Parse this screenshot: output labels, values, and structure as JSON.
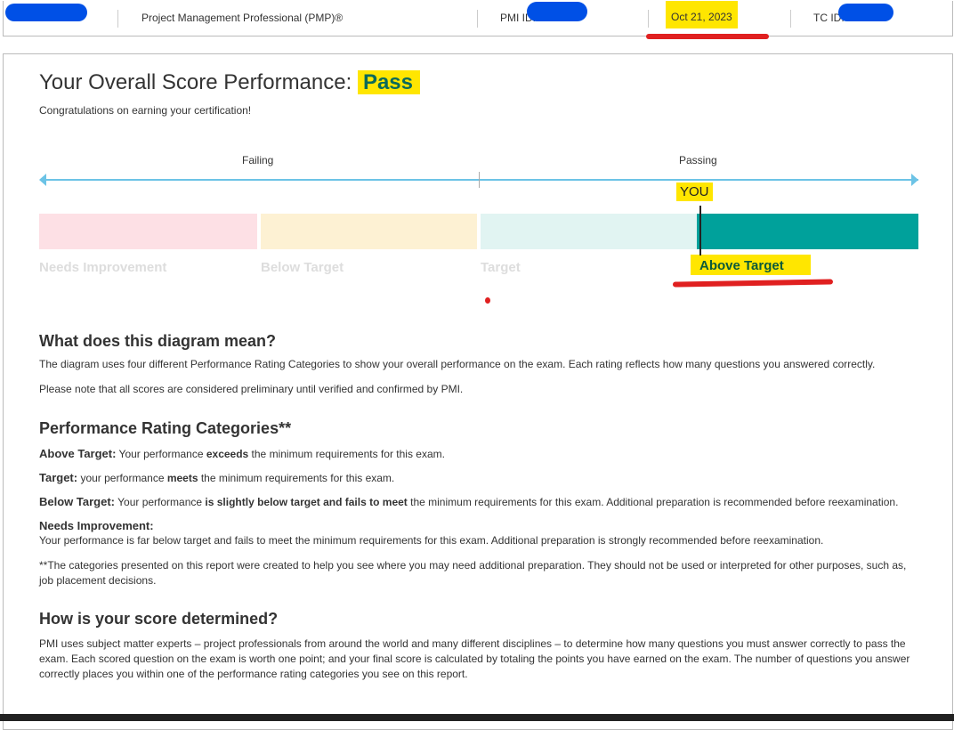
{
  "header": {
    "certification": "Project Management Professional (PMP)®",
    "pmi_id_label": "PMI ID:",
    "date": "Oct 21, 2023",
    "tc_id_label": "TC ID:"
  },
  "score": {
    "title": "Your Overall Score Performance:",
    "result": "Pass",
    "congrats": "Congratulations on earning your certification!"
  },
  "diagram": {
    "failing": "Failing",
    "passing": "Passing",
    "you": "YOU",
    "selected": "Above Target",
    "categories": [
      {
        "label": "Needs Improvement",
        "color": "#fde0e5"
      },
      {
        "label": "Below Target",
        "color": "#fdf1d3"
      },
      {
        "label": "Target",
        "color": "#e1f4f2"
      },
      {
        "label": "Above Target",
        "color": "#00a19b"
      }
    ]
  },
  "meaning": {
    "heading": "What does this diagram mean?",
    "p1": "The diagram uses four different Performance Rating Categories to show your overall performance on the exam. Each rating reflects how many questions you answered correctly.",
    "p2": "Please note that all scores are considered preliminary until verified and confirmed by PMI."
  },
  "ratings": {
    "heading": "Performance Rating Categories**",
    "above": {
      "term": "Above Target:",
      "a": " Your performance ",
      "b": "exceeds",
      "c": " the minimum requirements for this exam."
    },
    "target": {
      "term": "Target:",
      "a": " your performance ",
      "b": "meets",
      "c": " the minimum requirements for this exam."
    },
    "below": {
      "term": "Below Target:",
      "a": " Your performance ",
      "b": "is slightly below target and fails to meet",
      "c": " the minimum requirements for this exam. Additional preparation is recommended before reexamination."
    },
    "needs": {
      "term": "Needs Improvement:",
      "text": "Your performance is far below target and fails to meet the minimum requirements for this exam. Additional preparation is strongly recommended before reexamination."
    },
    "note": "**The categories presented on this report were created to help you see where you may need additional preparation. They should not be used or interpreted for other purposes, such as, job placement decisions."
  },
  "determined": {
    "heading": "How is your score determined?",
    "text": "PMI uses subject matter experts – project professionals from around the world and many different disciplines – to determine how many questions you must answer correctly to pass the exam. Each scored question on the exam is worth one point; and your final score is calculated by totaling the points you have earned on the exam. The number of questions you answer correctly places you within one of the performance rating categories you see on this report."
  }
}
